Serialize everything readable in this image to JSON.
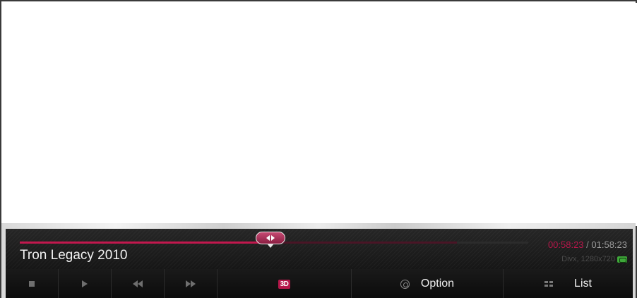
{
  "player": {
    "title": "Tron Legacy 2010",
    "time_current": "00:58:23",
    "time_separator": " / ",
    "time_total": "01:58:23",
    "format_info": "Divx, 1280x720",
    "format_badge_icon": "subtitle-badge-icon",
    "progress": 0.493,
    "buffered": 0.86,
    "accent_color": "#c2184e"
  },
  "controls": {
    "stop_icon": "stop-icon",
    "play_icon": "play-icon",
    "rewind_icon": "rewind-icon",
    "fast_forward_icon": "fast-forward-icon",
    "three_d_label": "3D",
    "option_label": "Option",
    "option_icon": "gear-icon",
    "list_label": "List",
    "list_icon": "grid-icon"
  }
}
